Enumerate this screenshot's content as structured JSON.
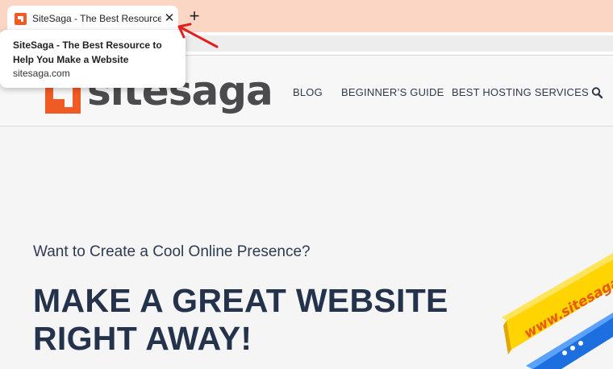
{
  "browser": {
    "tab": {
      "title": "SiteSaga - The Best Resource to Help You Make a Website",
      "close_icon": "close-icon",
      "favicon": "sitesaga-favicon"
    },
    "new_tab_icon": "plus-icon",
    "tooltip": {
      "title": "SiteSaga - The Best Resource to Help You Make a Website",
      "url": "sitesaga.com"
    },
    "annotation_color": "#e0201f"
  },
  "site": {
    "logo_text": "sitesaga",
    "brand_color": "#f05a24",
    "nav": {
      "blog": "BLOG",
      "guide": "BEGINNER’S GUIDE",
      "hosting": "BEST HOSTING SERVICES"
    },
    "search_icon": "search-icon"
  },
  "hero": {
    "subtitle": "Want to Create a Cool Online Presence?",
    "title_line1": "MAKE A GREAT WEBSITE",
    "title_line2": "RIGHT AWAY!",
    "deco_text": "www.sitesaga"
  }
}
